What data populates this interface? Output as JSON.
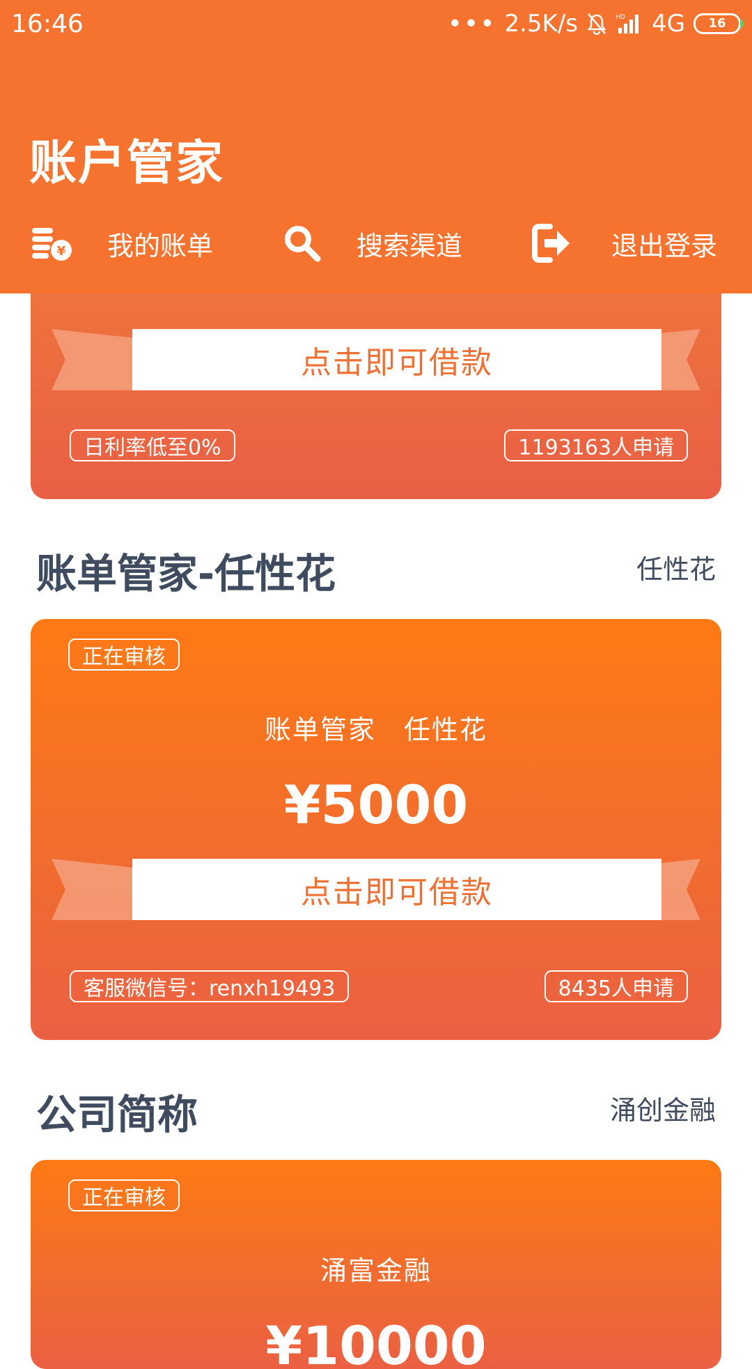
{
  "status_bar": {
    "time": "16:46",
    "net_speed": "2.5K/s",
    "network": "4G",
    "battery": "16"
  },
  "header": {
    "title": "账户管家"
  },
  "nav": [
    {
      "label": "我的账单",
      "icon": "bill-coin-icon"
    },
    {
      "label": "搜索渠道",
      "icon": "search-icon"
    },
    {
      "label": "退出登录",
      "icon": "logout-icon"
    }
  ],
  "top_card": {
    "button": "点击即可借款",
    "tag_left": "日利率低至0%",
    "tag_right": "1193163人申请"
  },
  "sections": [
    {
      "title": "账单管家-任性花",
      "subtitle": "任性花",
      "card": {
        "status": "正在审核",
        "name": "账单管家　任性花",
        "amount": "¥5000",
        "button": "点击即可借款",
        "tag_left": "客服微信号：renxh19493",
        "tag_right": "8435人申请"
      }
    },
    {
      "title": "公司简称",
      "subtitle": "涌创金融",
      "card": {
        "status": "正在审核",
        "name": "涌富金融",
        "amount": "¥10000"
      }
    }
  ],
  "colors": {
    "header": "#f5732e",
    "card_top": "#ff7a14",
    "card_bottom": "#eb6043",
    "title_text": "#3f4b5e"
  }
}
